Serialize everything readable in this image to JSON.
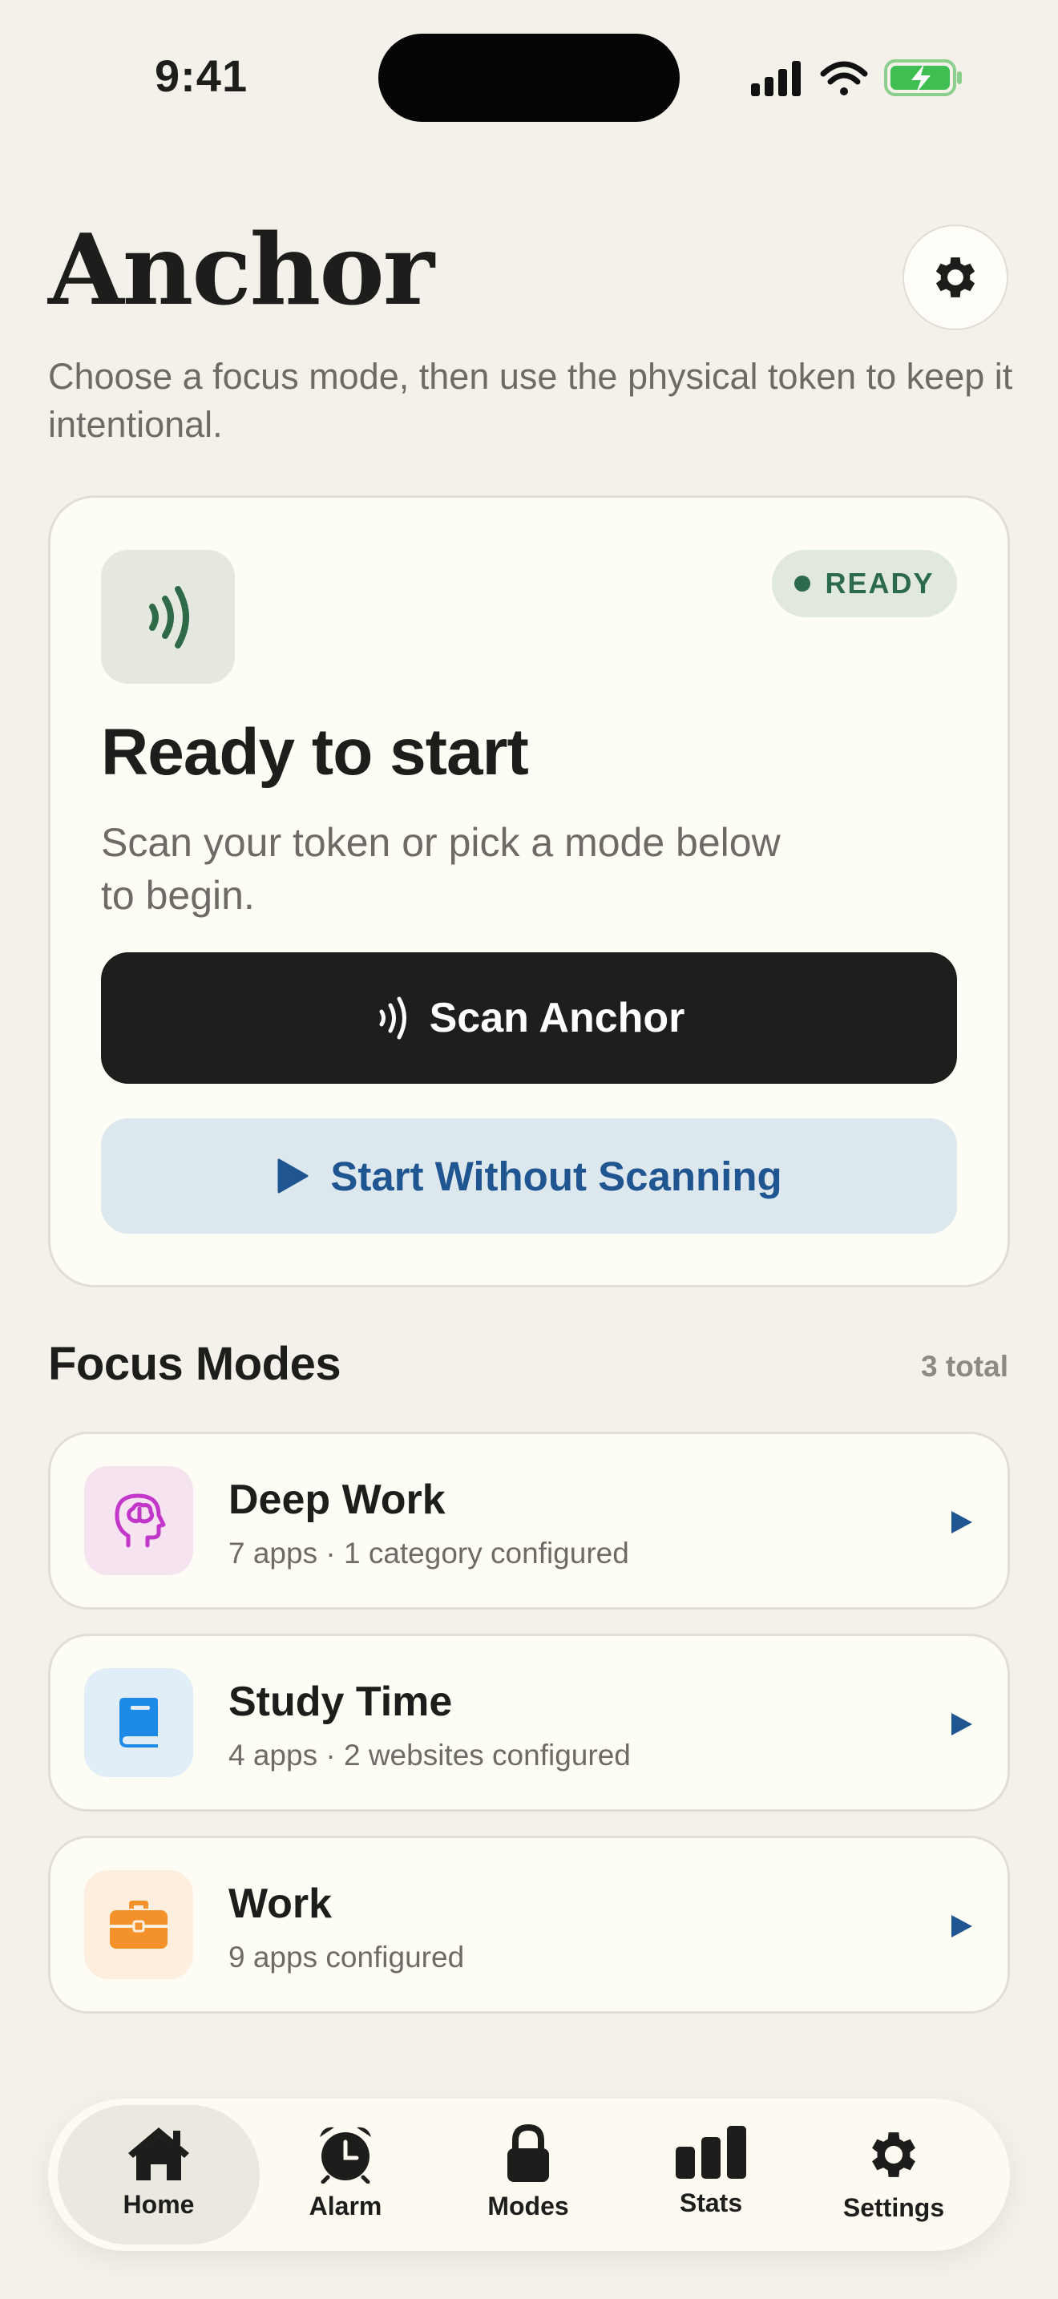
{
  "status_bar": {
    "time": "9:41"
  },
  "header": {
    "title": "Anchor",
    "subtitle": "Choose a focus mode, then use the physical token to keep it intentional."
  },
  "hero": {
    "badge": "READY",
    "title": "Ready to start",
    "description": "Scan your token or pick a mode below to begin.",
    "scan_label": "Scan Anchor",
    "start_label": "Start Without Scanning"
  },
  "focus_modes": {
    "title": "Focus Modes",
    "count": "3 total",
    "items": [
      {
        "name": "Deep Work",
        "meta": "7 apps · 1 category configured",
        "icon": "brain-head-icon",
        "tint": "#f6e3f0",
        "color": "#c236c9"
      },
      {
        "name": "Study Time",
        "meta": "4 apps · 2 websites configured",
        "icon": "book-icon",
        "tint": "#e1eef8",
        "color": "#1e8ae8"
      },
      {
        "name": "Work",
        "meta": "9 apps configured",
        "icon": "briefcase-icon",
        "tint": "#fdeedd",
        "color": "#f3922b"
      }
    ]
  },
  "tabs": [
    {
      "label": "Home",
      "icon": "house-icon",
      "active": true
    },
    {
      "label": "Alarm",
      "icon": "alarm-clock-icon",
      "active": false
    },
    {
      "label": "Modes",
      "icon": "lock-icon",
      "active": false
    },
    {
      "label": "Stats",
      "icon": "bar-chart-icon",
      "active": false
    },
    {
      "label": "Settings",
      "icon": "gear-icon",
      "active": false
    }
  ],
  "colors": {
    "background": "#f4f1ea",
    "card": "#fdfcf5",
    "ready_green": "#2c6a4c",
    "primary_button": "#1e1e1d",
    "secondary_button": "#dde7ee",
    "accent_blue": "#1f5590"
  }
}
